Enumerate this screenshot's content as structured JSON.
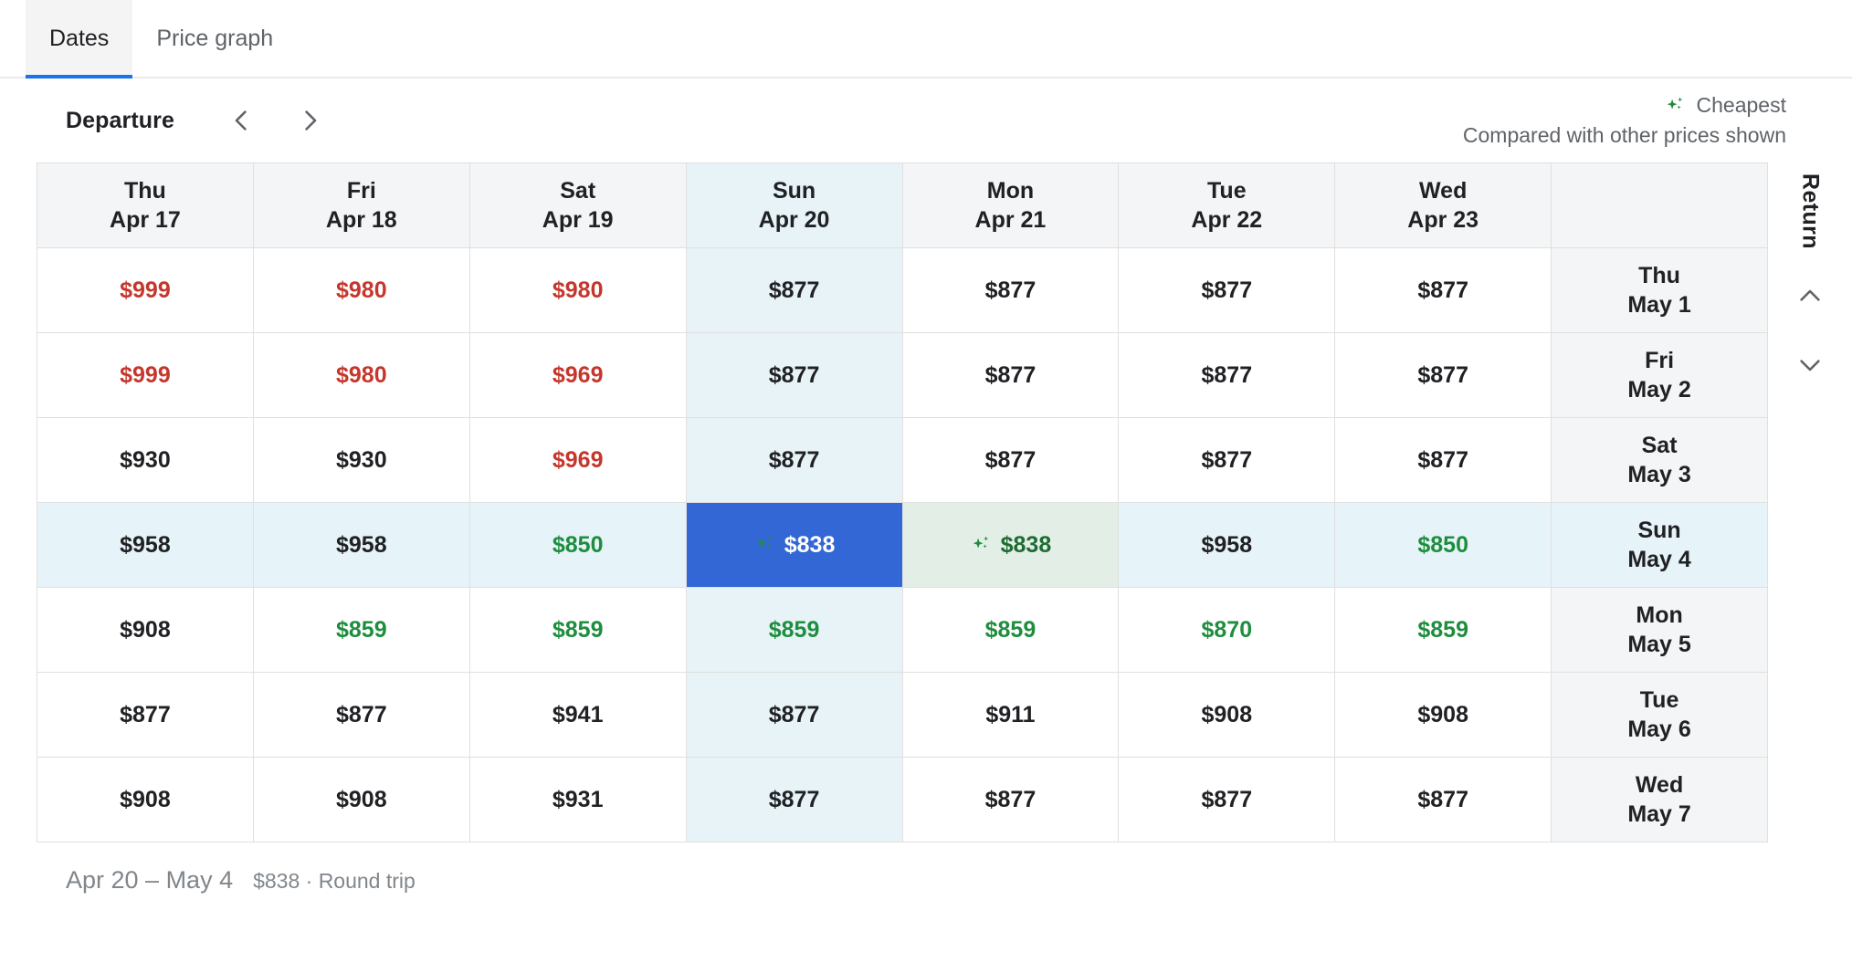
{
  "tabs": [
    {
      "label": "Dates",
      "active": true
    },
    {
      "label": "Price graph",
      "active": false
    }
  ],
  "controls": {
    "departure_label": "Departure",
    "prev_icon": "chevron-left-icon",
    "next_icon": "chevron-right-icon",
    "cheapest_label": "Cheapest",
    "cheapest_icon": "sparkle-icon",
    "cheapest_note": "Compared with other prices shown"
  },
  "return_rail": {
    "label": "Return",
    "up_icon": "chevron-up-icon",
    "down_icon": "chevron-down-icon"
  },
  "colors": {
    "accent_blue": "#3367d6",
    "tab_underline": "#1a73e8",
    "price_high": "#c5372c",
    "price_low": "#1e8e3e",
    "cheapest_bg": "#e3efe6",
    "cheapest_text": "#1e6b33",
    "selected_column_bg": "#e7f3f7",
    "header_bg": "#f4f5f6"
  },
  "grid": {
    "departure_days": [
      {
        "weekday": "Thu",
        "date": "Apr 17",
        "selected": false
      },
      {
        "weekday": "Fri",
        "date": "Apr 18",
        "selected": false
      },
      {
        "weekday": "Sat",
        "date": "Apr 19",
        "selected": false
      },
      {
        "weekday": "Sun",
        "date": "Apr 20",
        "selected": true
      },
      {
        "weekday": "Mon",
        "date": "Apr 21",
        "selected": false
      },
      {
        "weekday": "Tue",
        "date": "Apr 22",
        "selected": false
      },
      {
        "weekday": "Wed",
        "date": "Apr 23",
        "selected": false
      }
    ],
    "return_days": [
      {
        "weekday": "Thu",
        "date": "May 1",
        "selected": false
      },
      {
        "weekday": "Fri",
        "date": "May 2",
        "selected": false
      },
      {
        "weekday": "Sat",
        "date": "May 3",
        "selected": false
      },
      {
        "weekday": "Sun",
        "date": "May 4",
        "selected": true
      },
      {
        "weekday": "Mon",
        "date": "May 5",
        "selected": false
      },
      {
        "weekday": "Tue",
        "date": "May 6",
        "selected": false
      },
      {
        "weekday": "Wed",
        "date": "May 7",
        "selected": false
      }
    ],
    "rows": [
      [
        {
          "price": "$999",
          "level": "high"
        },
        {
          "price": "$980",
          "level": "high"
        },
        {
          "price": "$980",
          "level": "high"
        },
        {
          "price": "$877",
          "level": "normal"
        },
        {
          "price": "$877",
          "level": "normal"
        },
        {
          "price": "$877",
          "level": "normal"
        },
        {
          "price": "$877",
          "level": "normal"
        }
      ],
      [
        {
          "price": "$999",
          "level": "high"
        },
        {
          "price": "$980",
          "level": "high"
        },
        {
          "price": "$969",
          "level": "high"
        },
        {
          "price": "$877",
          "level": "normal"
        },
        {
          "price": "$877",
          "level": "normal"
        },
        {
          "price": "$877",
          "level": "normal"
        },
        {
          "price": "$877",
          "level": "normal"
        }
      ],
      [
        {
          "price": "$930",
          "level": "normal"
        },
        {
          "price": "$930",
          "level": "normal"
        },
        {
          "price": "$969",
          "level": "high"
        },
        {
          "price": "$877",
          "level": "normal"
        },
        {
          "price": "$877",
          "level": "normal"
        },
        {
          "price": "$877",
          "level": "normal"
        },
        {
          "price": "$877",
          "level": "normal"
        }
      ],
      [
        {
          "price": "$958",
          "level": "normal"
        },
        {
          "price": "$958",
          "level": "normal"
        },
        {
          "price": "$850",
          "level": "low"
        },
        {
          "price": "$838",
          "level": "low",
          "state": "selected",
          "sparkle": true
        },
        {
          "price": "$838",
          "level": "low",
          "state": "cheapest",
          "sparkle": true
        },
        {
          "price": "$958",
          "level": "normal"
        },
        {
          "price": "$850",
          "level": "low"
        }
      ],
      [
        {
          "price": "$908",
          "level": "normal"
        },
        {
          "price": "$859",
          "level": "low"
        },
        {
          "price": "$859",
          "level": "low"
        },
        {
          "price": "$859",
          "level": "low"
        },
        {
          "price": "$859",
          "level": "low"
        },
        {
          "price": "$870",
          "level": "low"
        },
        {
          "price": "$859",
          "level": "low"
        }
      ],
      [
        {
          "price": "$877",
          "level": "normal"
        },
        {
          "price": "$877",
          "level": "normal"
        },
        {
          "price": "$941",
          "level": "normal"
        },
        {
          "price": "$877",
          "level": "normal"
        },
        {
          "price": "$911",
          "level": "normal"
        },
        {
          "price": "$908",
          "level": "normal"
        },
        {
          "price": "$908",
          "level": "normal"
        }
      ],
      [
        {
          "price": "$908",
          "level": "normal"
        },
        {
          "price": "$908",
          "level": "normal"
        },
        {
          "price": "$931",
          "level": "normal"
        },
        {
          "price": "$877",
          "level": "normal"
        },
        {
          "price": "$877",
          "level": "normal"
        },
        {
          "price": "$877",
          "level": "normal"
        },
        {
          "price": "$877",
          "level": "normal"
        }
      ]
    ]
  },
  "footer": {
    "date_range": "Apr 20 – May 4",
    "price_summary": "$838 · Round trip"
  }
}
